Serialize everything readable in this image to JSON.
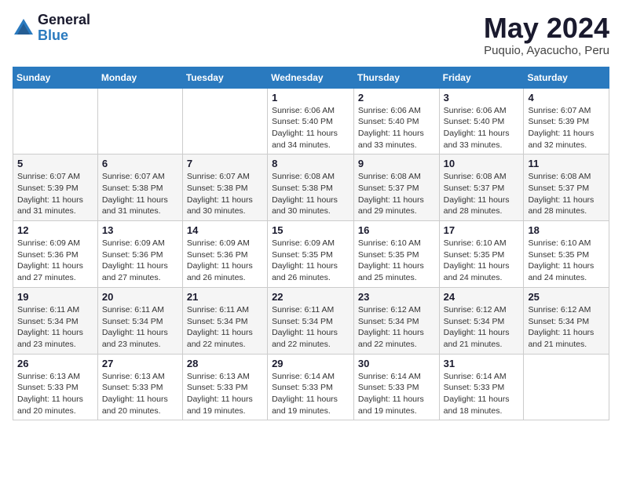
{
  "logo": {
    "general": "General",
    "blue": "Blue"
  },
  "title": "May 2024",
  "location": "Puquio, Ayacucho, Peru",
  "days_of_week": [
    "Sunday",
    "Monday",
    "Tuesday",
    "Wednesday",
    "Thursday",
    "Friday",
    "Saturday"
  ],
  "weeks": [
    [
      {
        "num": "",
        "info": ""
      },
      {
        "num": "",
        "info": ""
      },
      {
        "num": "",
        "info": ""
      },
      {
        "num": "1",
        "info": "Sunrise: 6:06 AM\nSunset: 5:40 PM\nDaylight: 11 hours and 34 minutes."
      },
      {
        "num": "2",
        "info": "Sunrise: 6:06 AM\nSunset: 5:40 PM\nDaylight: 11 hours and 33 minutes."
      },
      {
        "num": "3",
        "info": "Sunrise: 6:06 AM\nSunset: 5:40 PM\nDaylight: 11 hours and 33 minutes."
      },
      {
        "num": "4",
        "info": "Sunrise: 6:07 AM\nSunset: 5:39 PM\nDaylight: 11 hours and 32 minutes."
      }
    ],
    [
      {
        "num": "5",
        "info": "Sunrise: 6:07 AM\nSunset: 5:39 PM\nDaylight: 11 hours and 31 minutes."
      },
      {
        "num": "6",
        "info": "Sunrise: 6:07 AM\nSunset: 5:38 PM\nDaylight: 11 hours and 31 minutes."
      },
      {
        "num": "7",
        "info": "Sunrise: 6:07 AM\nSunset: 5:38 PM\nDaylight: 11 hours and 30 minutes."
      },
      {
        "num": "8",
        "info": "Sunrise: 6:08 AM\nSunset: 5:38 PM\nDaylight: 11 hours and 30 minutes."
      },
      {
        "num": "9",
        "info": "Sunrise: 6:08 AM\nSunset: 5:37 PM\nDaylight: 11 hours and 29 minutes."
      },
      {
        "num": "10",
        "info": "Sunrise: 6:08 AM\nSunset: 5:37 PM\nDaylight: 11 hours and 28 minutes."
      },
      {
        "num": "11",
        "info": "Sunrise: 6:08 AM\nSunset: 5:37 PM\nDaylight: 11 hours and 28 minutes."
      }
    ],
    [
      {
        "num": "12",
        "info": "Sunrise: 6:09 AM\nSunset: 5:36 PM\nDaylight: 11 hours and 27 minutes."
      },
      {
        "num": "13",
        "info": "Sunrise: 6:09 AM\nSunset: 5:36 PM\nDaylight: 11 hours and 27 minutes."
      },
      {
        "num": "14",
        "info": "Sunrise: 6:09 AM\nSunset: 5:36 PM\nDaylight: 11 hours and 26 minutes."
      },
      {
        "num": "15",
        "info": "Sunrise: 6:09 AM\nSunset: 5:35 PM\nDaylight: 11 hours and 26 minutes."
      },
      {
        "num": "16",
        "info": "Sunrise: 6:10 AM\nSunset: 5:35 PM\nDaylight: 11 hours and 25 minutes."
      },
      {
        "num": "17",
        "info": "Sunrise: 6:10 AM\nSunset: 5:35 PM\nDaylight: 11 hours and 24 minutes."
      },
      {
        "num": "18",
        "info": "Sunrise: 6:10 AM\nSunset: 5:35 PM\nDaylight: 11 hours and 24 minutes."
      }
    ],
    [
      {
        "num": "19",
        "info": "Sunrise: 6:11 AM\nSunset: 5:34 PM\nDaylight: 11 hours and 23 minutes."
      },
      {
        "num": "20",
        "info": "Sunrise: 6:11 AM\nSunset: 5:34 PM\nDaylight: 11 hours and 23 minutes."
      },
      {
        "num": "21",
        "info": "Sunrise: 6:11 AM\nSunset: 5:34 PM\nDaylight: 11 hours and 22 minutes."
      },
      {
        "num": "22",
        "info": "Sunrise: 6:11 AM\nSunset: 5:34 PM\nDaylight: 11 hours and 22 minutes."
      },
      {
        "num": "23",
        "info": "Sunrise: 6:12 AM\nSunset: 5:34 PM\nDaylight: 11 hours and 22 minutes."
      },
      {
        "num": "24",
        "info": "Sunrise: 6:12 AM\nSunset: 5:34 PM\nDaylight: 11 hours and 21 minutes."
      },
      {
        "num": "25",
        "info": "Sunrise: 6:12 AM\nSunset: 5:34 PM\nDaylight: 11 hours and 21 minutes."
      }
    ],
    [
      {
        "num": "26",
        "info": "Sunrise: 6:13 AM\nSunset: 5:33 PM\nDaylight: 11 hours and 20 minutes."
      },
      {
        "num": "27",
        "info": "Sunrise: 6:13 AM\nSunset: 5:33 PM\nDaylight: 11 hours and 20 minutes."
      },
      {
        "num": "28",
        "info": "Sunrise: 6:13 AM\nSunset: 5:33 PM\nDaylight: 11 hours and 19 minutes."
      },
      {
        "num": "29",
        "info": "Sunrise: 6:14 AM\nSunset: 5:33 PM\nDaylight: 11 hours and 19 minutes."
      },
      {
        "num": "30",
        "info": "Sunrise: 6:14 AM\nSunset: 5:33 PM\nDaylight: 11 hours and 19 minutes."
      },
      {
        "num": "31",
        "info": "Sunrise: 6:14 AM\nSunset: 5:33 PM\nDaylight: 11 hours and 18 minutes."
      },
      {
        "num": "",
        "info": ""
      }
    ]
  ]
}
